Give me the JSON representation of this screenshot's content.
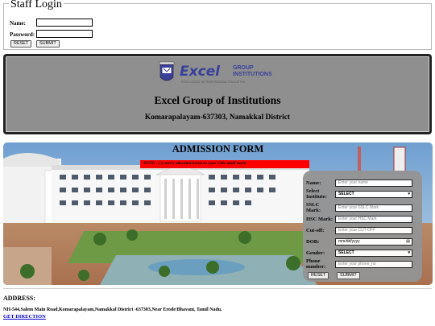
{
  "staff_login": {
    "legend": "Staff Login",
    "name_label": "Name:",
    "password_label": "Password:",
    "name_value": "",
    "password_value": "",
    "reset_label": "RESET",
    "submit_label": "SUBMIT"
  },
  "header": {
    "logo_word": "Excel",
    "logo_group": "GROUP",
    "logo_institutions": "INSTITUTIONS",
    "logo_tagline": "EXCELLENCE IN PROFESSIONAL EDUCATION",
    "title": "Excel Group of Institutions",
    "address": "Komarapalayam-637303, Namakkal District"
  },
  "admission": {
    "title": "ADMISSION FORM",
    "note": "NOTE : ( )) seat is allocated based on your 12th cutoff mark",
    "fields": {
      "name_label": "Name:",
      "name_placeholder": "Enter your name",
      "institute_label_1": "Select",
      "institute_label_2": "Institute:",
      "institute_selected": "SELECT",
      "sslc_label_1": "SSLC",
      "sslc_label_2": "Mark:",
      "sslc_placeholder": "Enter your SSLC Mark",
      "hsc_label": "HSC Mark:",
      "hsc_placeholder": "Enter your HSC Mark",
      "cutoff_label": "Cut-off:",
      "cutoff_placeholder": "Enter your CUT-OFF",
      "dob_label": "DOB:",
      "dob_placeholder": "mm/dd/yyyy",
      "gender_label": "Gender:",
      "gender_selected": "SELECT",
      "phone_label_1": "Phone",
      "phone_label_2": "number:",
      "phone_placeholder": "Enter your phone_no",
      "reset_label": "RESET",
      "submit_label": "SUBMIT"
    }
  },
  "footer": {
    "heading": "ADDRESS:",
    "text": "NH-544,Salem Main Road,Komarapalayam,Namakkal District -637303,Near Erode/Bhavani, Tamil Nadu.",
    "link": "GET DIRECTION"
  },
  "colors": {
    "header_bg": "#8f8f8f",
    "note_bg": "#ff0000",
    "form_bg": "#949494",
    "link": "#0000cc",
    "logo_blue": "#3a3f9a"
  }
}
